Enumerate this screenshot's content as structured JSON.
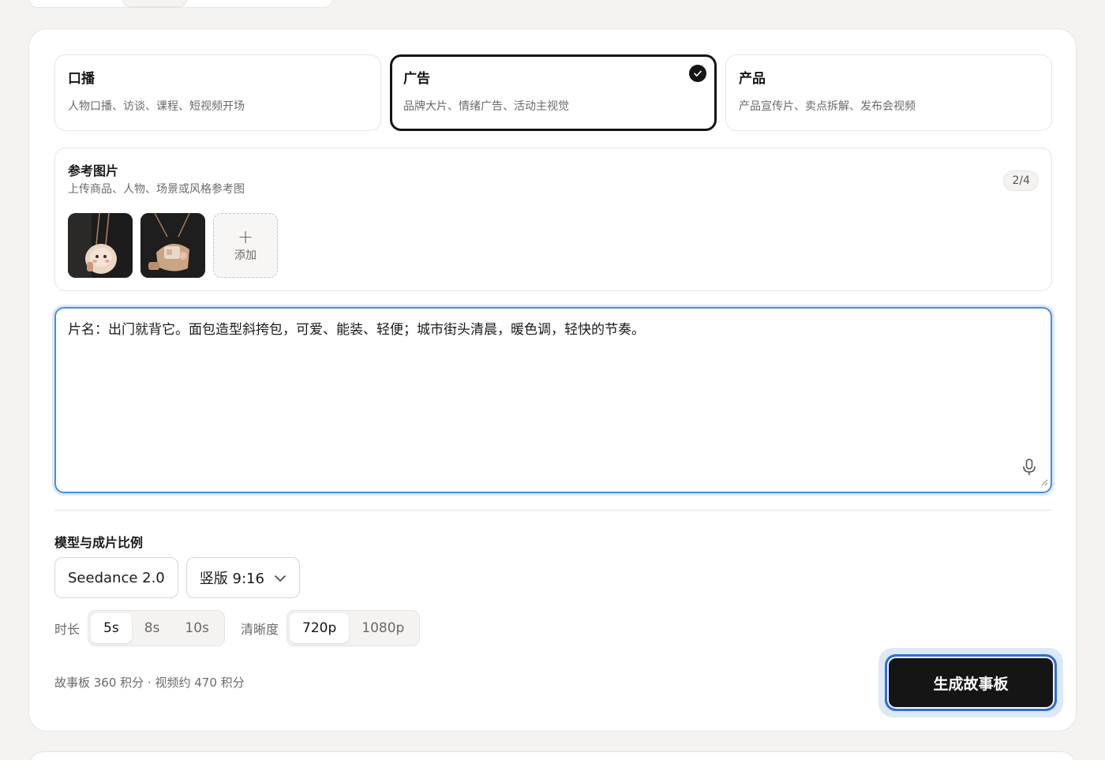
{
  "modes": [
    {
      "title": "口播",
      "desc": "人物口播、访谈、课程、短视频开场",
      "selected": false
    },
    {
      "title": "广告",
      "desc": "品牌大片、情绪广告、活动主视觉",
      "selected": true
    },
    {
      "title": "产品",
      "desc": "产品宣传片、卖点拆解、发布会视频",
      "selected": false
    }
  ],
  "references": {
    "title": "参考图片",
    "subtitle": "上传商品、人物、场景或风格参考图",
    "count": "2/4",
    "add_label": "添加",
    "add_icon": "plus-icon"
  },
  "prompt": {
    "value": "片名：出门就背它。面包造型斜挎包，可爱、能装、轻便；城市街头清晨，暖色调，轻快的节奏。",
    "mic_icon": "microphone-icon"
  },
  "settings": {
    "section_label": "模型与成片比例",
    "model": "Seedance 2.0",
    "ratio": "竖版 9:16",
    "duration_label": "时长",
    "durations": [
      "5s",
      "8s",
      "10s"
    ],
    "duration_selected": "5s",
    "resolution_label": "清晰度",
    "resolutions": [
      "720p",
      "1080p"
    ],
    "resolution_selected": "720p"
  },
  "cost": "故事板 360 积分 · 视频约 470 积分",
  "generate_label": "生成故事板",
  "colors": {
    "accent": "#151515",
    "focus": "#4a8de0",
    "background": "#f4f3f1"
  }
}
